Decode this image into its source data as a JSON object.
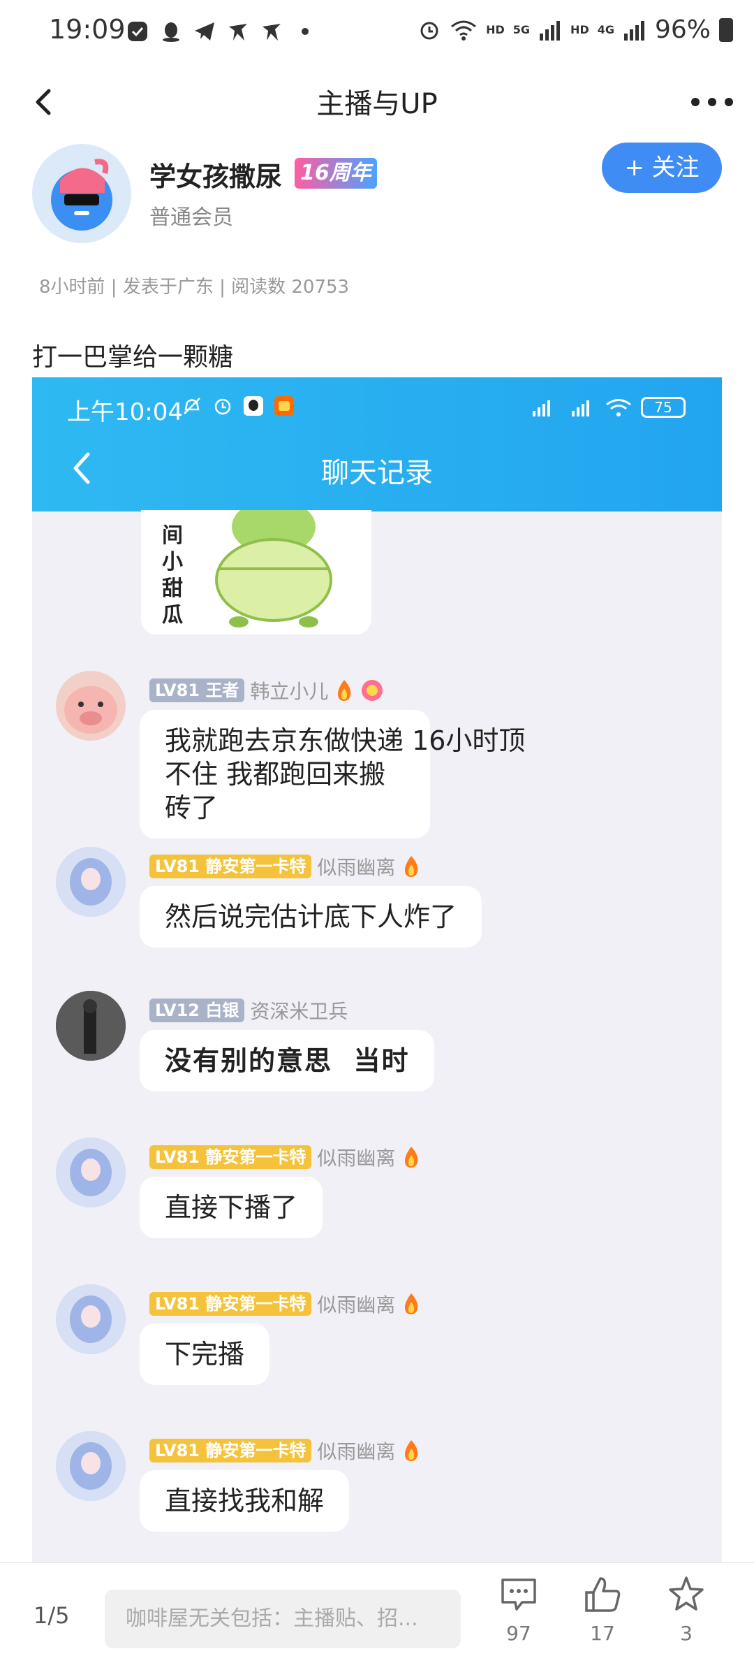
{
  "status_bar": {
    "time": "19:09",
    "hd1": "HD",
    "net1": "5G",
    "hd2": "HD",
    "net2": "4G",
    "battery": "96%"
  },
  "header": {
    "title": "主播与UP"
  },
  "author": {
    "name": "学女孩撒尿",
    "badge": "16周年",
    "role": "普通会员",
    "follow_label": "+ 关注"
  },
  "post": {
    "meta": "8小时前 | 发表于广东 | 阅读数 20753",
    "text": "打一巴掌给一颗糖"
  },
  "screenshot": {
    "time": "上午10:04",
    "battery": "75",
    "title": "聊天记录",
    "sticker_text": "间小甜瓜",
    "messages": [
      {
        "level": "LV81 王者",
        "level_color": "gray",
        "nick": "韩立小儿",
        "text1": "我就跑去京东做快递 16小时顶",
        "text2": "不住 我都跑回来搬砖了"
      },
      {
        "level": "LV81 静安第一卡特",
        "level_color": "gold",
        "nick": "似雨幽离",
        "text1": "然后说完估计底下人炸了"
      },
      {
        "level": "LV12 白银",
        "level_color": "gray",
        "nick": "资深米卫兵",
        "text1": "没有别的意思  当时"
      },
      {
        "level": "LV81 静安第一卡特",
        "level_color": "gold",
        "nick": "似雨幽离",
        "text1": "直接下播了"
      },
      {
        "level": "LV81 静安第一卡特",
        "level_color": "gold",
        "nick": "似雨幽离",
        "text1": "下完播"
      },
      {
        "level": "LV81 静安第一卡特",
        "level_color": "gold",
        "nick": "似雨幽离",
        "text1": "直接找我和解"
      }
    ]
  },
  "bottom_bar": {
    "page": "1/5",
    "comment_placeholder": "咖啡屋无关包括：主播贴、招...",
    "comments": "97",
    "likes": "17",
    "favorites": "3"
  },
  "colors": {
    "accent": "#3f8cf5",
    "screenshot_header": "#2fb9f2",
    "gold_badge": "#f5c33b"
  }
}
